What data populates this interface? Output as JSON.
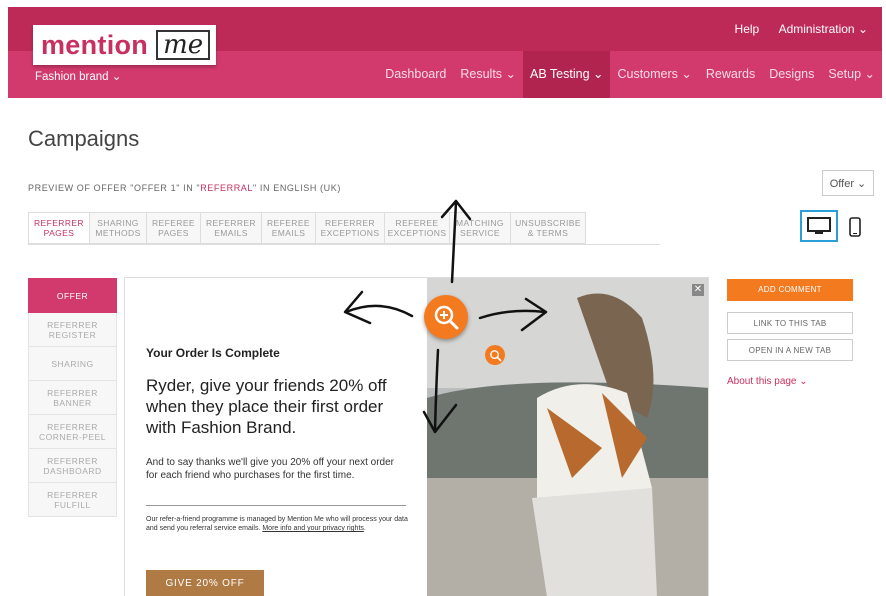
{
  "header": {
    "logo_main": "mention",
    "logo_me": "me",
    "top_links": [
      "Help",
      "Administration ⌄"
    ],
    "brand": "Fashion brand ⌄",
    "nav": [
      {
        "label": "Dashboard"
      },
      {
        "label": "Results ⌄"
      },
      {
        "label": "AB Testing ⌄",
        "active": true
      },
      {
        "label": "Customers ⌄"
      },
      {
        "label": "Rewards"
      },
      {
        "label": "Designs"
      },
      {
        "label": "Setup ⌄"
      }
    ]
  },
  "page": {
    "title": "Campaigns",
    "preview_prefix": "PREVIEW OF OFFER \"OFFER 1\" IN \"",
    "preview_highlight": "REFERRAL",
    "preview_suffix": "\" IN ENGLISH (UK)",
    "offer_dropdown": "Offer ⌄"
  },
  "tabs": [
    "REFERRER\nPAGES",
    "SHARING\nMETHODS",
    "REFEREE\nPAGES",
    "REFERRER\nEMAILS",
    "REFEREE\nEMAILS",
    "REFERRER\nEXCEPTIONS",
    "REFEREE\nEXCEPTIONS",
    "MATCHING\nSERVICE",
    "UNSUBSCRIBE\n& TERMS"
  ],
  "sidebar": [
    "OFFER",
    "REFERRER\nREGISTER",
    "SHARING",
    "REFERRER\nBANNER",
    "REFERRER\nCORNER-PEEL",
    "REFERRER\nDASHBOARD",
    "REFERRER\nFULFILL"
  ],
  "preview": {
    "close": "✕",
    "heading": "Your Order Is Complete",
    "big_text": "Ryder, give your friends 20% off when they place their first order with Fashion Brand.",
    "body_text": "And to say thanks we'll give you 20% off your next order for each friend who purchases for the first time.",
    "small_text": "Our refer-a-friend programme is managed by Mention Me who will process your data and send you referral service emails.",
    "small_link": "More info and your privacy rights",
    "cta": "GIVE 20% OFF"
  },
  "actions": {
    "add_comment": "ADD COMMENT",
    "link_tab": "LINK TO THIS TAB",
    "open_new_tab": "OPEN IN A NEW TAB",
    "about": "About this page ⌄"
  },
  "colors": {
    "brand_pink": "#d2396d",
    "brand_dark": "#be2a58",
    "accent_orange": "#f47a20",
    "device_blue": "#2a9fd6"
  }
}
